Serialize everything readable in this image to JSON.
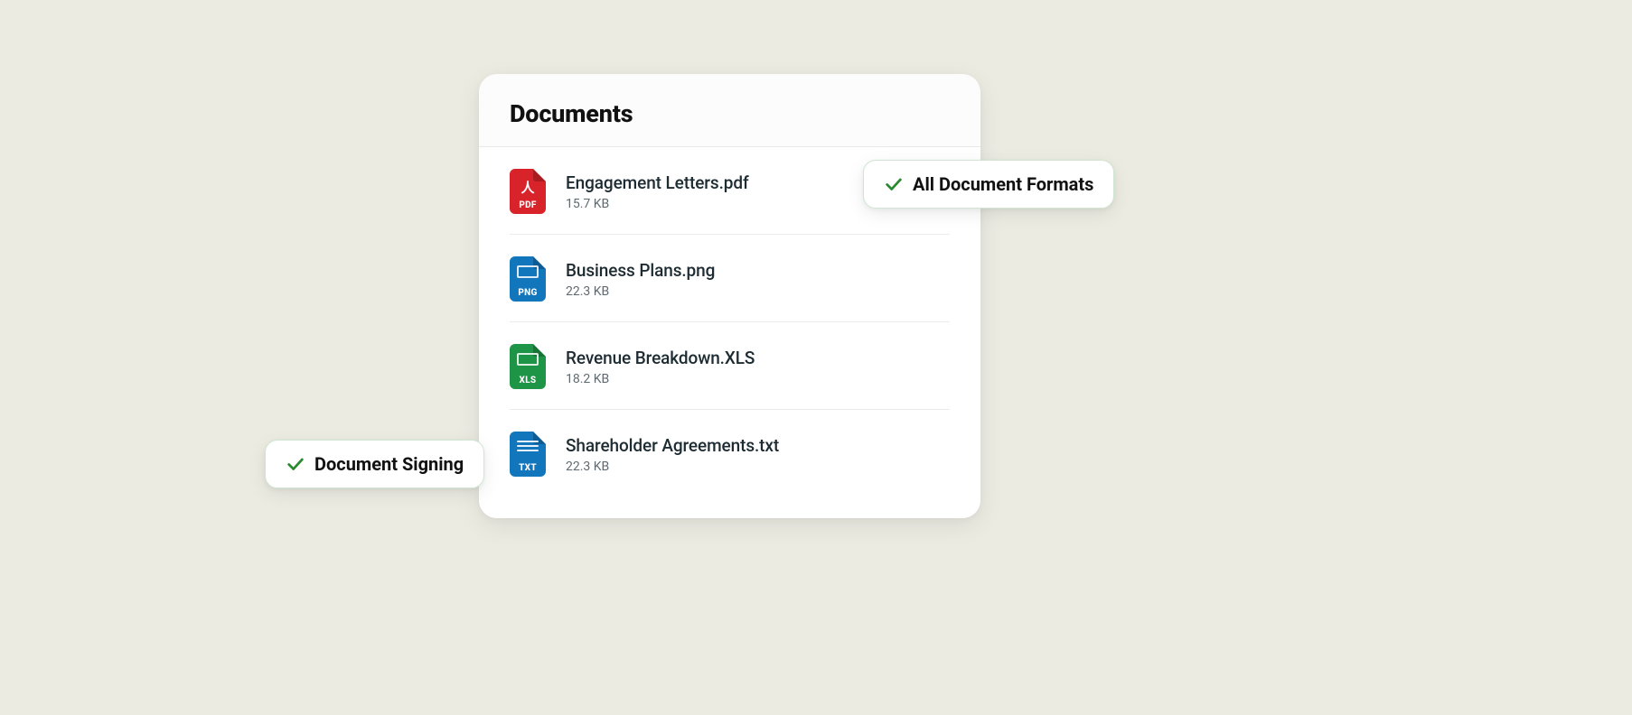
{
  "card": {
    "title": "Documents",
    "files": [
      {
        "name": "Engagement Letters.pdf",
        "size": "15.7 KB",
        "type": "pdf",
        "ext": "PDF"
      },
      {
        "name": "Business Plans.png",
        "size": "22.3 KB",
        "type": "png",
        "ext": "PNG"
      },
      {
        "name": "Revenue Breakdown.XLS",
        "size": "18.2 KB",
        "type": "xls",
        "ext": "XLS"
      },
      {
        "name": "Shareholder Agreements.txt",
        "size": "22.3 KB",
        "type": "txt",
        "ext": "TXT"
      }
    ]
  },
  "badges": {
    "right": "All Document Formats",
    "left": "Document Signing"
  }
}
